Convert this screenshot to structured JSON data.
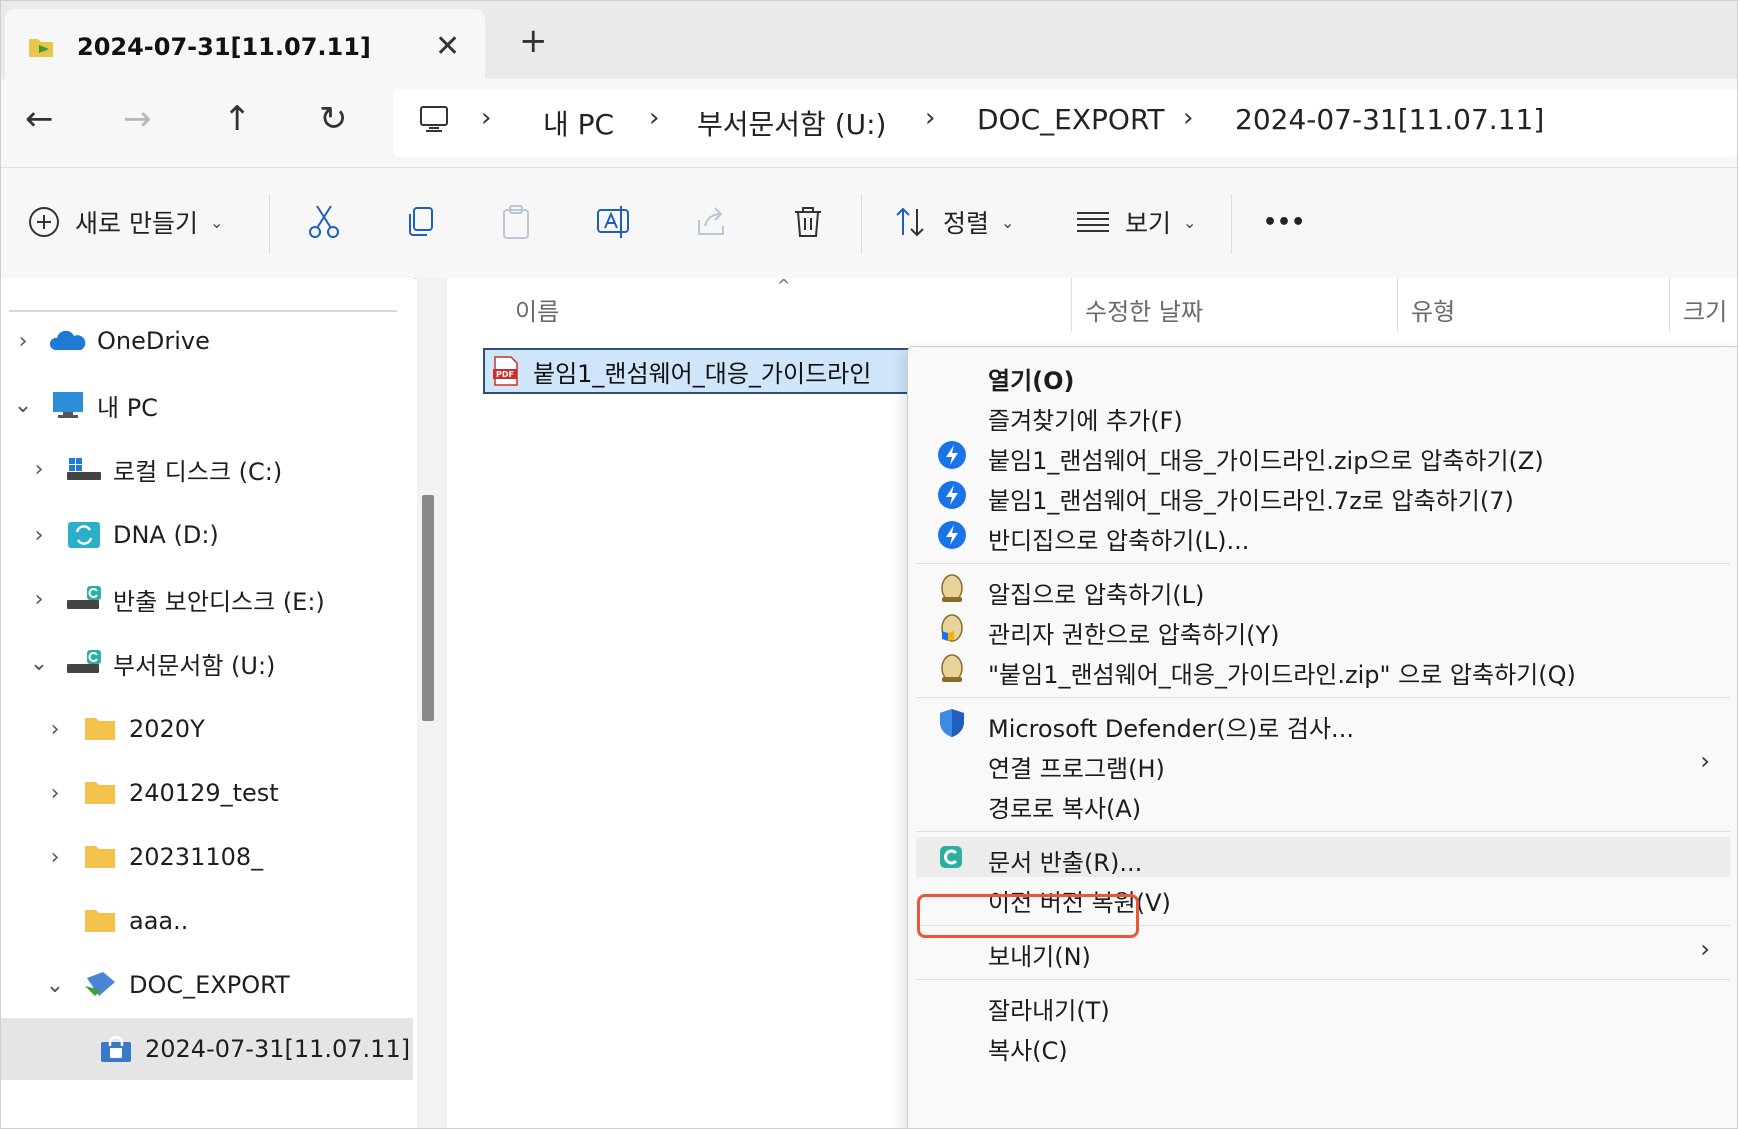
{
  "tab": {
    "title": "2024-07-31[11.07.11]",
    "close": "✕",
    "new_tab": "+"
  },
  "nav": {
    "back": "←",
    "forward": "→",
    "up": "↑",
    "refresh": "↻"
  },
  "breadcrumb": {
    "separator": "›",
    "items": [
      "내 PC",
      "부서문서함 (U:)",
      "DOC_EXPORT",
      "2024-07-31[11.07.11]"
    ]
  },
  "commandbar": {
    "new_label": "새로 만들기",
    "sort_label": "정렬",
    "view_label": "보기",
    "more": "•••",
    "caret": "⌄"
  },
  "sidebar": {
    "items": [
      {
        "label": "OneDrive",
        "chevron": "›"
      },
      {
        "label": "내 PC",
        "chevron": "⌄"
      },
      {
        "label": "로컬 디스크 (C:)",
        "chevron": "›"
      },
      {
        "label": "DNA (D:)",
        "chevron": "›"
      },
      {
        "label": "반출 보안디스크 (E:)",
        "chevron": "›"
      },
      {
        "label": "부서문서함 (U:)",
        "chevron": "⌄"
      },
      {
        "label": "2020Y",
        "chevron": "›"
      },
      {
        "label": "240129_test",
        "chevron": "›"
      },
      {
        "label": "20231108_",
        "chevron": "›"
      },
      {
        "label": "aaa..",
        "chevron": ""
      },
      {
        "label": "DOC_EXPORT",
        "chevron": "⌄"
      },
      {
        "label": "2024-07-31[11.07.11]",
        "chevron": ""
      }
    ]
  },
  "columns": {
    "name": "이름",
    "modified": "수정한 날짜",
    "type": "유형",
    "size": "크기",
    "sort_indicator": "^"
  },
  "file": {
    "name": "붙임1_랜섬웨어_대응_가이드라인",
    "badge": "PDF"
  },
  "context_menu": {
    "submenu_arrow": "›",
    "items": [
      {
        "label": "열기(O)"
      },
      {
        "label": "즐겨찾기에 추가(F)"
      },
      {
        "label": "붙임1_랜섬웨어_대응_가이드라인.zip으로 압축하기(Z)"
      },
      {
        "label": "붙임1_랜섬웨어_대응_가이드라인.7z로 압축하기(7)"
      },
      {
        "label": "반디집으로 압축하기(L)..."
      },
      {
        "label": "알집으로 압축하기(L)"
      },
      {
        "label": "관리자 권한으로 압축하기(Y)"
      },
      {
        "label": "\"붙임1_랜섬웨어_대응_가이드라인.zip\" 으로 압축하기(Q)"
      },
      {
        "label": "Microsoft Defender(으)로 검사..."
      },
      {
        "label": "연결 프로그램(H)"
      },
      {
        "label": "경로로 복사(A)"
      },
      {
        "label": "문서 반출(R)..."
      },
      {
        "label": "이전 버전 복원(V)"
      },
      {
        "label": "보내기(N)"
      },
      {
        "label": "잘라내기(T)"
      },
      {
        "label": "복사(C)"
      }
    ]
  },
  "colors": {
    "highlight_box": "#e8573a",
    "selection": "#cfe5fa",
    "accent_blue": "#1a73e8"
  }
}
